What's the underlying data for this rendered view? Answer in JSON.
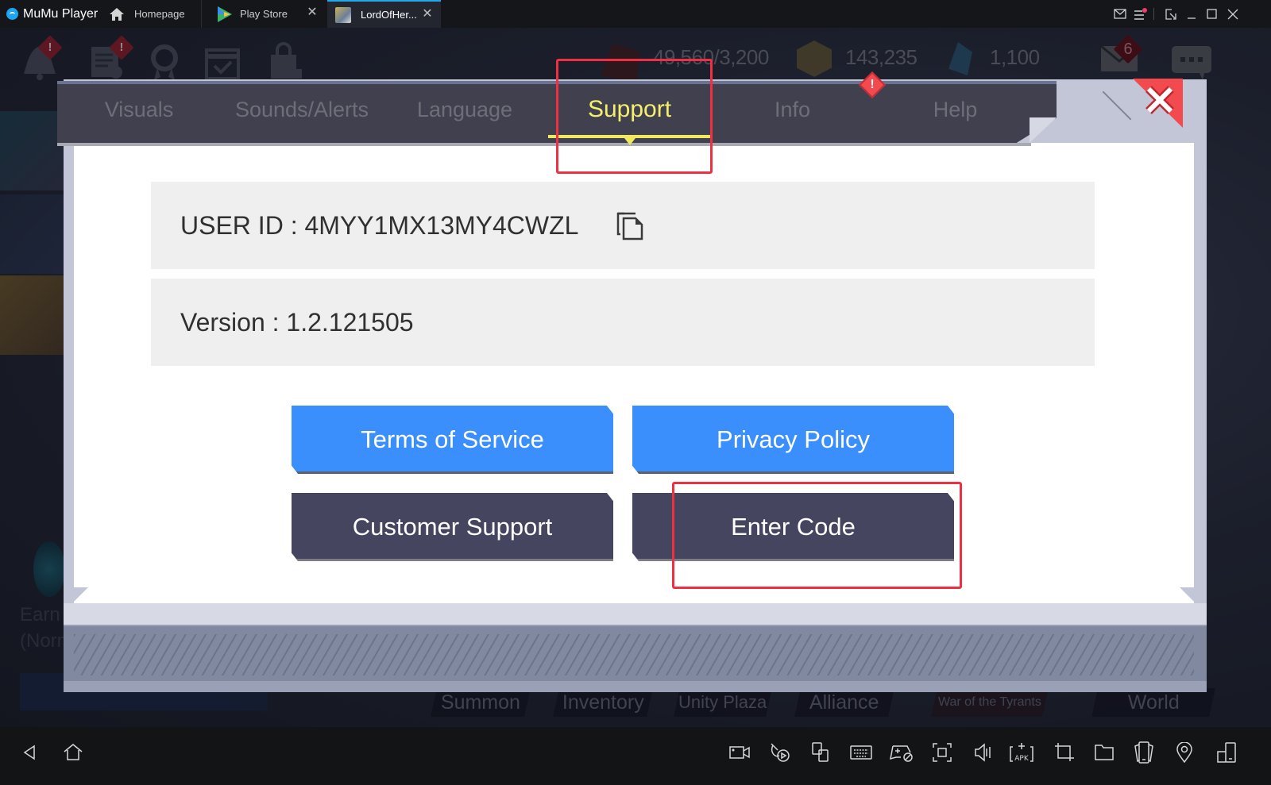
{
  "titlebar": {
    "app_name": "MuMu Player",
    "tabs": [
      {
        "label": "Homepage",
        "icon": "home-icon",
        "closable": false
      },
      {
        "label": "Play Store",
        "icon": "play-store-icon",
        "closable": true
      },
      {
        "label": "LordOfHer...",
        "icon": "game-thumbnail-icon",
        "closable": true,
        "active": true
      }
    ],
    "close_glyph": "✕",
    "window_controls": [
      "mail-icon",
      "menu-icon",
      "pin-window-icon",
      "minimize-icon",
      "maximize-icon",
      "close-icon"
    ],
    "menu_has_notification": true
  },
  "game_hud": {
    "top_icons": [
      {
        "name": "notice-bell-icon",
        "alert": "!"
      },
      {
        "name": "quest-log-icon",
        "alert": "!"
      },
      {
        "name": "achievement-badge-icon"
      },
      {
        "name": "calendar-checkin-icon"
      },
      {
        "name": "locked-shop-icon"
      }
    ],
    "resources": [
      {
        "name": "stamina",
        "value": "49,560/3,200"
      },
      {
        "name": "gold",
        "value": "143,235"
      },
      {
        "name": "gems",
        "value": "1,100"
      }
    ],
    "mail_badge": "6",
    "earn_text_line1": "Earn",
    "earn_text_line2": "(Norm",
    "bottom_nav": [
      "Summon",
      "Inventory",
      "Unity Plaza",
      "Alliance",
      "War of the Tyrants",
      "World"
    ]
  },
  "dialog": {
    "tabs": [
      {
        "label": "Visuals",
        "active": false
      },
      {
        "label": "Sounds/Alerts",
        "active": false
      },
      {
        "label": "Language",
        "active": false
      },
      {
        "label": "Support",
        "active": true
      },
      {
        "label": "Info",
        "active": false,
        "alert": "!"
      },
      {
        "label": "Help",
        "active": false
      }
    ],
    "user_id_label": "USER ID : 4MYY1MX13MY4CWZL",
    "version_label": "Version : 1.2.121505",
    "buttons": {
      "terms": "Terms of Service",
      "privacy": "Privacy Policy",
      "support": "Customer Support",
      "enter_code": "Enter Code"
    },
    "colors": {
      "active_tab": "#f4ef6c",
      "blue_button": "#3a8ffc",
      "dark_button": "#45455f",
      "close": "#f24a4e",
      "highlight": "#ef3043"
    }
  },
  "toolbar": {
    "left": [
      "back-icon",
      "home-icon"
    ],
    "right": [
      "record-video-icon",
      "operation-record-icon",
      "multi-instance-icon",
      "keyboard-icon",
      "gamepad-icon",
      "fullscreen-icon",
      "volume-icon",
      "install-apk-icon",
      "screenshot-crop-icon",
      "shared-folder-icon",
      "rotate-screen-icon",
      "location-icon",
      "multi-window-icon"
    ],
    "apk_text": "APK"
  }
}
